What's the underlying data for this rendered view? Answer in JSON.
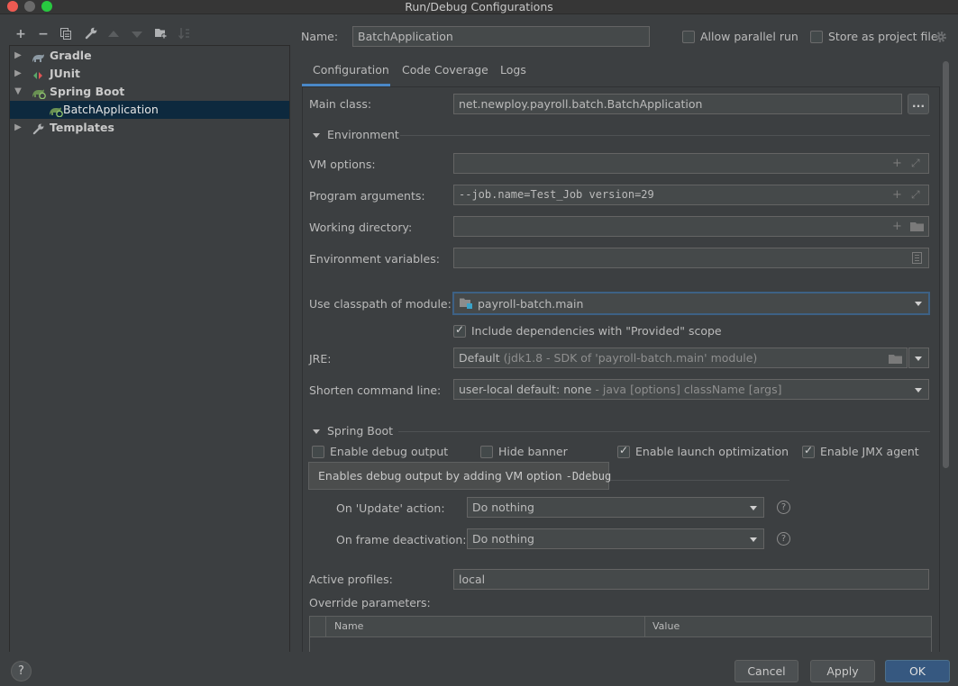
{
  "window": {
    "title": "Run/Debug Configurations"
  },
  "toolbar": {
    "add": "+",
    "remove": "−"
  },
  "tree": {
    "gradle": "Gradle",
    "junit": "JUnit",
    "spring_boot": "Spring Boot",
    "batch_app": "BatchApplication",
    "templates": "Templates"
  },
  "header": {
    "name_label": "Name:",
    "name_value": "BatchApplication",
    "parallel_label": "Allow parallel run",
    "store_label": "Store as project file"
  },
  "tabs": {
    "configuration": "Configuration",
    "coverage": "Code Coverage",
    "logs": "Logs"
  },
  "form": {
    "main_class_label": "Main class:",
    "main_class_value": "net.newploy.payroll.batch.BatchApplication",
    "browse": "...",
    "environment": "Environment",
    "vm_label": "VM options:",
    "vm_value": "",
    "args_label": "Program arguments:",
    "args_value": "--job.name=Test_Job version=29",
    "workdir_label": "Working directory:",
    "workdir_value": "",
    "env_label": "Environment variables:",
    "env_value": "",
    "classpath_label": "Use classpath of module:",
    "classpath_value": "payroll-batch.main",
    "include_deps": "Include dependencies with \"Provided\" scope",
    "jre_label": "JRE:",
    "jre_default": "Default",
    "jre_detail": "(jdk1.8 - SDK of 'payroll-batch.main' module)",
    "shorten_label": "Shorten command line:",
    "shorten_value": "user-local default: none",
    "shorten_detail": "- java [options] className [args]",
    "spring_boot": "Spring Boot",
    "debug_output": "Enable debug output",
    "hide_banner": "Hide banner",
    "launch_opt": "Enable launch optimization",
    "jmx": "Enable JMX agent",
    "tooltip_text": "Enables debug output by adding VM option ",
    "tooltip_code": "-Ddebug",
    "update_label": "On 'Update' action:",
    "update_value": "Do nothing",
    "frame_label": "On frame deactivation:",
    "frame_value": "Do nothing",
    "profiles_label": "Active profiles:",
    "profiles_value": "local",
    "override_label": "Override parameters:",
    "col_name": "Name",
    "col_value": "Value"
  },
  "footer": {
    "help": "?",
    "cancel": "Cancel",
    "apply": "Apply",
    "ok": "OK"
  },
  "colors": {
    "accent": "#365880",
    "selection": "#0d293e",
    "focus": "#3d6185"
  }
}
